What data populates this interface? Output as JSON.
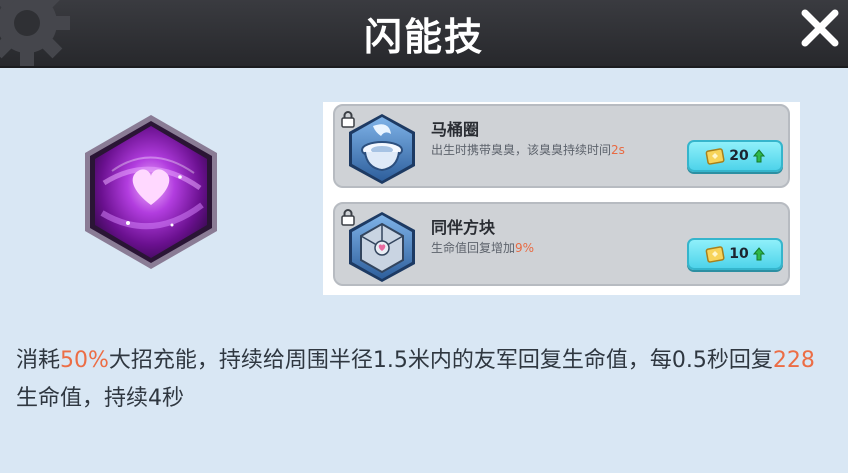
{
  "header": {
    "title": "闪能技"
  },
  "cards": [
    {
      "title": "马桶圈",
      "desc_text": "出生时携带臭臭，该臭臭持续时间",
      "desc_highlight": "2s",
      "cost": "20"
    },
    {
      "title": "同伴方块",
      "desc_text": "生命值回复增加",
      "desc_highlight": "9%",
      "cost": "10"
    }
  ],
  "description": {
    "p1": "消耗",
    "h1": "50%",
    "p2": "大招充能，持续给周围半径1.5米内的友军回复生命值，每0.5秒回复",
    "h2": "228",
    "p3": "生命值，持续4秒"
  },
  "colors": {
    "background": "#d9e7f4",
    "header": "#2f3034",
    "highlight": "#ec6d45",
    "cost_button": "#5ad8ec"
  },
  "icons": {
    "close": "close-icon",
    "lock": "lock-icon",
    "skill": "heart-hexagon-icon",
    "ticket": "ticket-icon",
    "upgrade": "green-up-arrow-icon"
  }
}
